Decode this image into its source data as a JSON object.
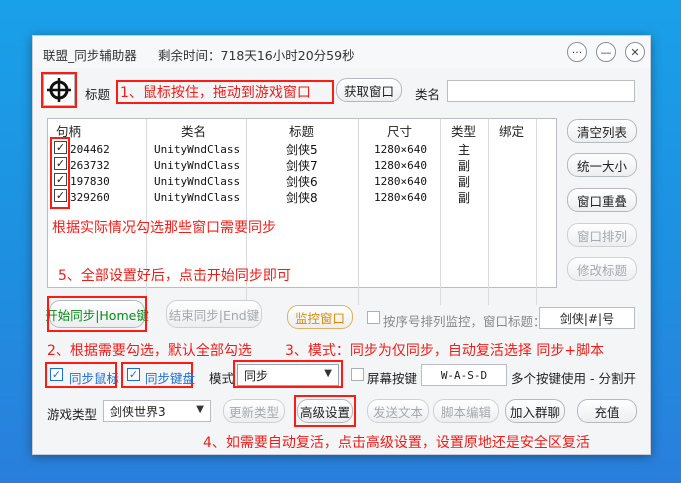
{
  "window": {
    "app_title": "联盟_同步辅助器",
    "remaining_time": "剩余时间：718天16小时20分59秒",
    "more_icon": "ellipsis-icon",
    "min_icon": "minimize-icon",
    "close_icon": "close-icon"
  },
  "top": {
    "title_label": "标题",
    "annotation1": "1、鼠标按住，拖动到游戏窗口",
    "get_window_button": "获取窗口",
    "classname_label": "类名",
    "title_value": "",
    "classname_value": ""
  },
  "table": {
    "headers": [
      "句柄",
      "类名",
      "标题",
      "尺寸",
      "类型",
      "绑定"
    ],
    "rows": [
      {
        "checked": true,
        "handle": "204462",
        "class": "UnityWndClass",
        "title": "剑侠5",
        "size": "1280×640",
        "type": "主",
        "bind": ""
      },
      {
        "checked": true,
        "handle": "263732",
        "class": "UnityWndClass",
        "title": "剑侠7",
        "size": "1280×640",
        "type": "副",
        "bind": ""
      },
      {
        "checked": true,
        "handle": "197830",
        "class": "UnityWndClass",
        "title": "剑侠6",
        "size": "1280×640",
        "type": "副",
        "bind": ""
      },
      {
        "checked": true,
        "handle": "329260",
        "class": "UnityWndClass",
        "title": "剑侠8",
        "size": "1280×640",
        "type": "副",
        "bind": ""
      }
    ],
    "annotation_check": "根据实际情况勾选那些窗口需要同步",
    "annotation5": "5、全部设置好后，点击开始同步即可"
  },
  "side": {
    "clear_list": "清空列表",
    "unify_size": "统一大小",
    "stack_windows": "窗口重叠",
    "arrange_windows": "窗口排列",
    "rename_title": "修改标题"
  },
  "sync": {
    "start": "开始同步|Home键",
    "stop": "结束同步|End键",
    "monitor": "监控窗口",
    "order_monitor": "按序号排列监控，窗口标题：",
    "title_pattern": "剑侠|#|号"
  },
  "annotation2": "2、根据需要勾选，默认全部勾选",
  "annotation3": "3、模式：同步为仅同步，自动复活选择 同步+脚本",
  "options": {
    "sync_mouse": "同步鼠标",
    "sync_keyboard": "同步键盘",
    "mode_label": "模式",
    "mode_value": "同步",
    "screen_keys": "屏幕按键",
    "keys_value": "W-A-S-D",
    "multi_keys_hint": "多个按键使用 - 分割开"
  },
  "bottom": {
    "game_type_label": "游戏类型",
    "game_type_value": "剑侠世界3",
    "update_type": "更新类型",
    "advanced": "高级设置",
    "send_text": "发送文本",
    "script_edit": "脚本编辑",
    "join_group": "加入群聊",
    "recharge": "充值"
  },
  "annotation4": "4、如需要自动复活，点击高级设置，设置原地还是安全区复活",
  "colors": {
    "accent_red": "#f01c18",
    "link_green": "#0a8a1a",
    "monitor_orange": "#e08a00",
    "desktop_blue": "#1e8fe0"
  }
}
